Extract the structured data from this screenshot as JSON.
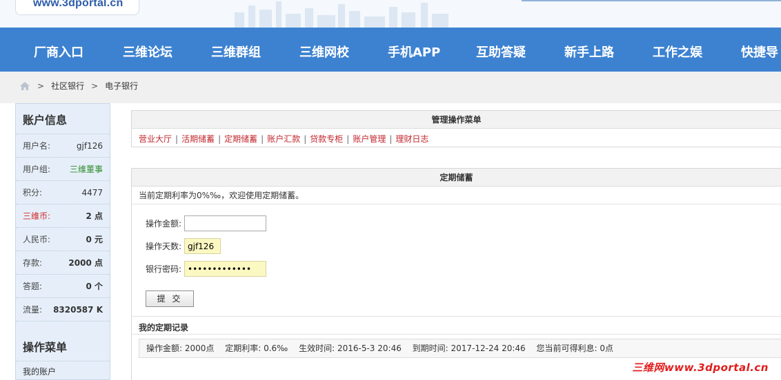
{
  "site": {
    "logo_text": "www.3dportal.cn",
    "watermark": "三维网www.3dportal.cn"
  },
  "nav": {
    "items": [
      {
        "label": "厂商入口"
      },
      {
        "label": "三维论坛"
      },
      {
        "label": "三维群组"
      },
      {
        "label": "三维网校"
      },
      {
        "label": "手机APP"
      },
      {
        "label": "互助答疑"
      },
      {
        "label": "新手上路"
      },
      {
        "label": "工作之娱"
      },
      {
        "label": "快捷导"
      }
    ],
    "color": "#3d82d1"
  },
  "breadcrumb": {
    "items": [
      {
        "label": "社区银行"
      },
      {
        "label": "电子银行"
      }
    ],
    "separator": ">"
  },
  "sidebar": {
    "account_title": "账户信息",
    "rows": [
      {
        "label": "用户名:",
        "value": "gjf126"
      },
      {
        "label": "用户组:",
        "value": "三维董事"
      },
      {
        "label": "积分:",
        "value": "4477"
      },
      {
        "label": "三维币:",
        "value": "2 点"
      },
      {
        "label": "人民币:",
        "value": "0 元"
      },
      {
        "label": "存款:",
        "value": "2000 点"
      },
      {
        "label": "答题:",
        "value": "0 个"
      },
      {
        "label": "流量:",
        "value": "8320587 K"
      }
    ],
    "menu_title": "操作菜单",
    "menu_items": [
      {
        "label": "我的账户"
      }
    ]
  },
  "manage_menu": {
    "title": "管理操作菜单",
    "links": [
      {
        "label": "营业大厅"
      },
      {
        "label": "活期储蓄"
      },
      {
        "label": "定期储蓄"
      },
      {
        "label": "账户汇款"
      },
      {
        "label": "贷款专柜"
      },
      {
        "label": "账户管理"
      },
      {
        "label": "理财日志"
      }
    ],
    "separator": "|"
  },
  "fixed_deposit": {
    "title": "定期储蓄",
    "notice": "当前定期利率为0%‰，欢迎使用定期储蓄。",
    "amount_label": "操作金额:",
    "amount_value": "",
    "days_label": "操作天数:",
    "days_value": "gjf126",
    "password_label": "银行密码:",
    "password_value": "•••••••••••••",
    "submit_label": "提 交"
  },
  "records": {
    "title": "我的定期记录",
    "entry": {
      "amount": "操作金额: 2000点",
      "rate": "定期利率: 0.6‰",
      "start": "生效时间: 2016-5-3 20:46",
      "end": "到期时间: 2017-12-24 20:46",
      "interest": "您当前可得利息: 0点"
    }
  }
}
